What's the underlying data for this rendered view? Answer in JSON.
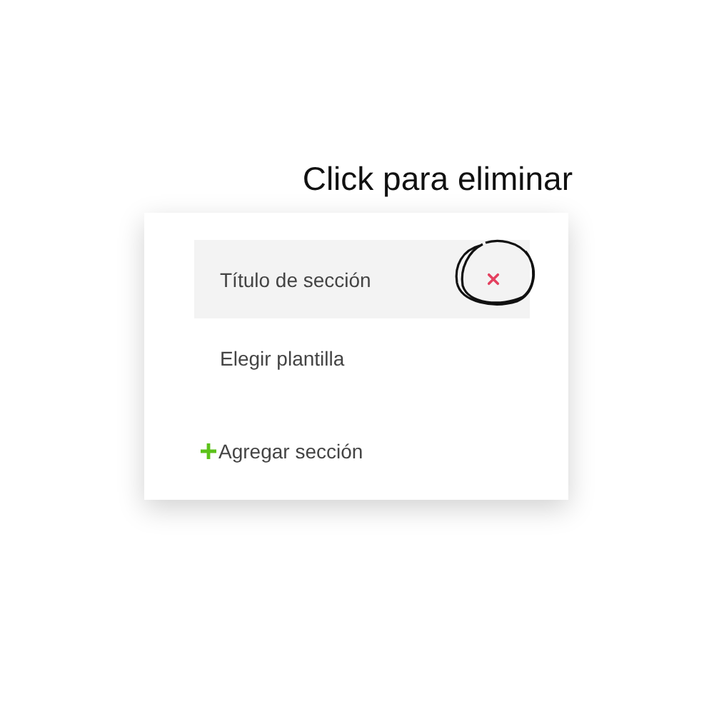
{
  "caption": "Click para eliminar",
  "items": [
    {
      "label": "Título de sección",
      "selected": true
    },
    {
      "label": "Elegir plantilla",
      "selected": false
    }
  ],
  "add_button": {
    "label": "Agregar sección"
  }
}
